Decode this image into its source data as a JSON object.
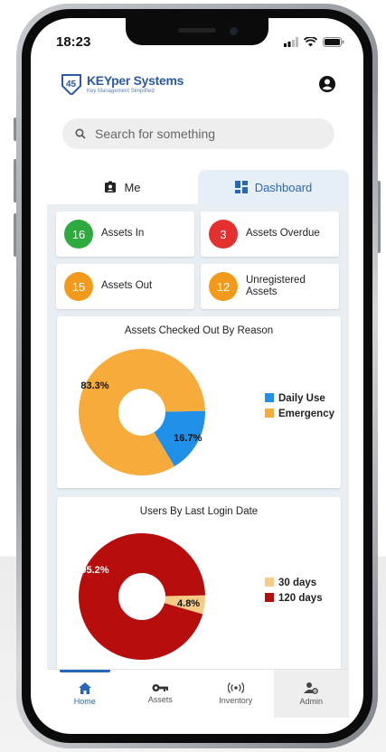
{
  "status": {
    "time": "18:23"
  },
  "header": {
    "brand": "KEYper Systems",
    "tagline": "Key Management Simplified"
  },
  "search": {
    "placeholder": "Search for something"
  },
  "tabs": [
    {
      "label": "Me"
    },
    {
      "label": "Dashboard"
    }
  ],
  "stats": [
    {
      "value": "16",
      "label": "Assets In",
      "color": "#2eaa3f"
    },
    {
      "value": "3",
      "label": "Assets Overdue",
      "color": "#e53030"
    },
    {
      "value": "15",
      "label": "Assets Out",
      "color": "#f39a1d"
    },
    {
      "value": "12",
      "label": "Unregistered Assets",
      "color": "#f39a1d"
    }
  ],
  "chart_data": [
    {
      "type": "pie",
      "title": "Assets Checked Out By Reason",
      "categories": [
        "Daily Use",
        "Emergency"
      ],
      "values": [
        16.7,
        83.3
      ],
      "labels": [
        "16.7%",
        "83.3%"
      ],
      "colors": [
        "#1f8fe8",
        "#f7ab3a"
      ],
      "legend": "right"
    },
    {
      "type": "pie",
      "title": "Users By Last Login Date",
      "categories": [
        "30 days",
        "120 days"
      ],
      "values": [
        4.8,
        95.2
      ],
      "labels": [
        "4.8%",
        "95.2%"
      ],
      "colors": [
        "#f7cb85",
        "#b80d0d"
      ],
      "legend": "right"
    }
  ],
  "nav": [
    {
      "label": "Home",
      "icon": "home-icon"
    },
    {
      "label": "Assets",
      "icon": "key-icon"
    },
    {
      "label": "Inventory",
      "icon": "rfid-icon"
    },
    {
      "label": "Admin",
      "icon": "admin-icon"
    }
  ],
  "colors": {
    "accent": "#2767b8",
    "panel": "#e9eef3"
  }
}
